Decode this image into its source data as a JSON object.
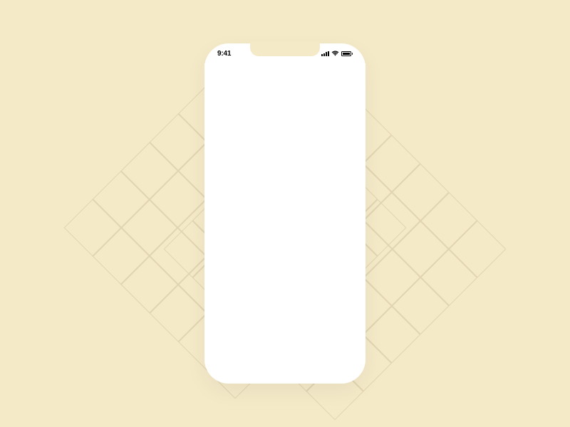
{
  "status_bar": {
    "time": "9:41"
  },
  "colors": {
    "background": "#f5eac8",
    "phone": "#ffffff",
    "status_text": "#000000",
    "grid_line": "#e0d4b0"
  }
}
